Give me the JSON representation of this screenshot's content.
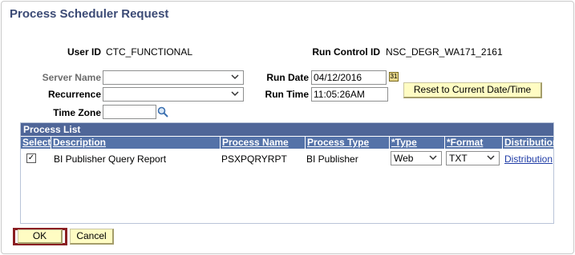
{
  "page_title": "Process Scheduler Request",
  "user_id_label": "User ID",
  "user_id_value": "CTC_FUNCTIONAL",
  "run_control_label": "Run Control ID",
  "run_control_value": "NSC_DEGR_WA171_2161",
  "server_name_label": "Server Name",
  "server_name_value": "",
  "recurrence_label": "Recurrence",
  "recurrence_value": "",
  "time_zone_label": "Time Zone",
  "time_zone_value": "",
  "run_date_label": "Run Date",
  "run_date_value": "04/12/2016",
  "run_time_label": "Run Time",
  "run_time_value": "11:05:26AM",
  "reset_button": "Reset to Current Date/Time",
  "process_list": {
    "title": "Process List",
    "headers": {
      "select": "Select",
      "description": "Description",
      "process_name": "Process Name",
      "process_type": "Process Type",
      "type": "*Type",
      "format": "*Format",
      "distribution": "Distribution"
    },
    "rows": [
      {
        "selected": true,
        "description": "BI Publisher Query Report",
        "process_name": "PSXPQRYRPT",
        "process_type": "BI Publisher",
        "type": "Web",
        "format": "TXT",
        "distribution": "Distribution"
      }
    ]
  },
  "ok_button": "OK",
  "cancel_button": "Cancel"
}
